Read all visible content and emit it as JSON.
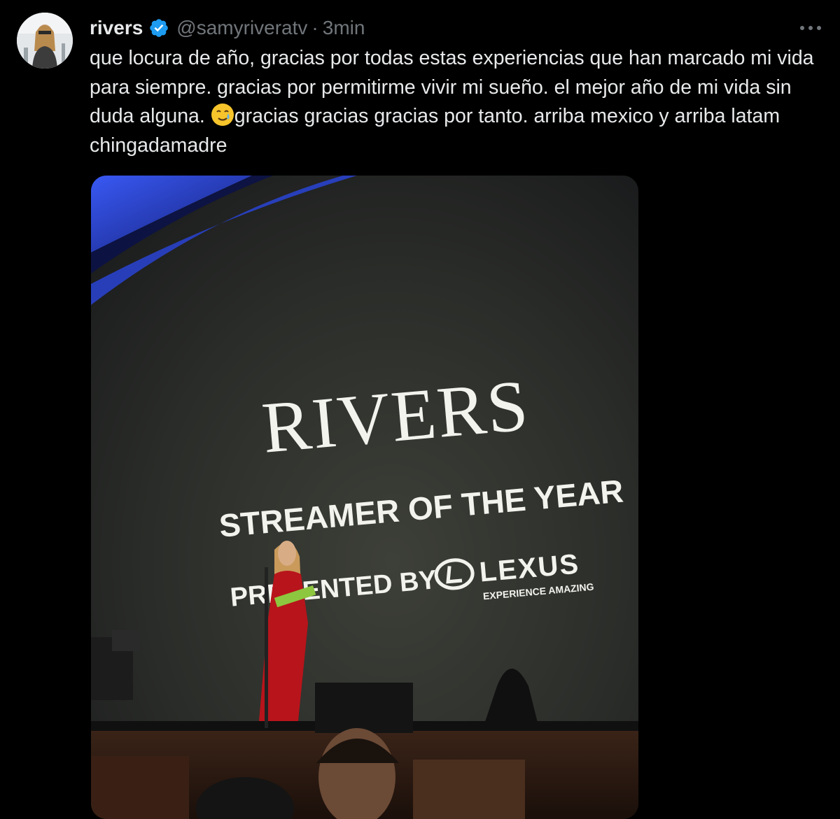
{
  "tweet": {
    "author_name": "rivers",
    "handle": "@samyriveratv",
    "separator": "·",
    "time": "3min",
    "text_before_emoji": "que locura de año, gracias por todas estas experiencias que han marcado mi vida para siempre. gracias por permitirme vivir mi sueño. el mejor año de mi vida sin duda alguna. ",
    "text_after_emoji": "gracias gracias gracias por tanto. arriba mexico y arriba latam chingadamadre",
    "emoji": "smiling-face-with-tear",
    "verified_badge_color": "#1d9bf0"
  },
  "photo": {
    "screen_title": "RIVERS",
    "screen_subtitle": "STREAMER OF THE YEAR",
    "screen_presented": "PRESENTED BY",
    "sponsor_brand": "LEXUS",
    "sponsor_tagline": "EXPERIENCE AMAZING"
  },
  "colors": {
    "background": "#000000",
    "text": "#e7e9ea",
    "muted": "#71767b",
    "accent": "#1d9bf0"
  }
}
